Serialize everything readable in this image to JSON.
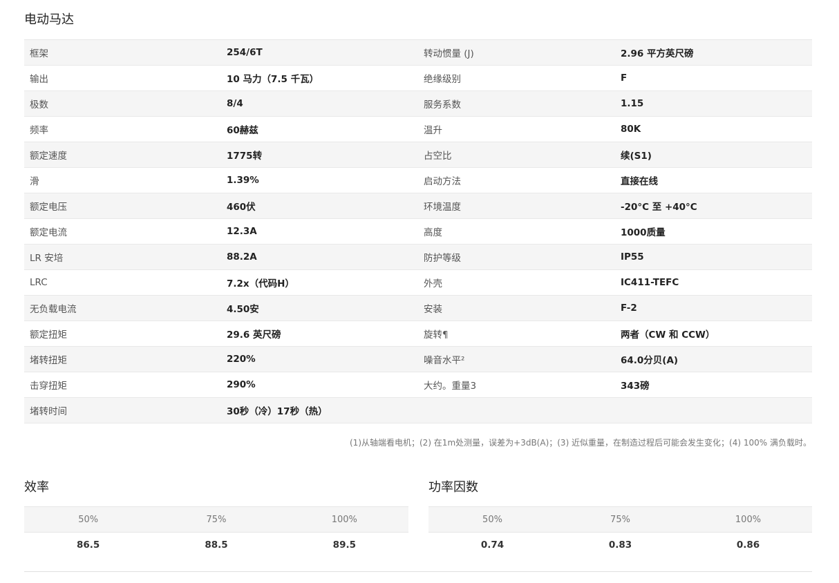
{
  "motor": {
    "title": "电动马达",
    "rows": [
      [
        "框架",
        "254/6T",
        "转动惯量 (J)",
        "2.96 平方英尺磅"
      ],
      [
        "输出",
        "10 马力（7.5 千瓦）",
        "绝缘级别",
        "F"
      ],
      [
        "极数",
        "8/4",
        "服务系数",
        "1.15"
      ],
      [
        "频率",
        "60赫兹",
        "温升",
        "80K"
      ],
      [
        "额定速度",
        "1775转",
        "占空比",
        "续(S1)"
      ],
      [
        "滑",
        "1.39%",
        "启动方法",
        "直接在线"
      ],
      [
        "额定电压",
        "460伏",
        "环境温度",
        "-20°C 至 +40°C"
      ],
      [
        "额定电流",
        "12.3A",
        "高度",
        "1000质量"
      ],
      [
        "LR 安培",
        "88.2A",
        "防护等级",
        "IP55"
      ],
      [
        "LRC",
        "7.2x（代码H）",
        "外壳",
        "IC411-TEFC"
      ],
      [
        "无负载电流",
        "4.50安",
        "安装",
        "F-2"
      ],
      [
        "额定扭矩",
        "29.6 英尺磅",
        "旋转¶",
        "两者（CW 和 CCW）"
      ],
      [
        "堵转扭矩",
        "220%",
        "噪音水平²",
        "64.0分贝(A)"
      ],
      [
        "击穿扭矩",
        "290%",
        "大约。重量3",
        "343磅"
      ],
      [
        "堵转时间",
        "30秒（冷）17秒（热）",
        "",
        ""
      ]
    ],
    "footnote": "(1)从轴端看电机；(2) 在1m处测量，误差为+3dB(A)；(3) 近似重量，在制造过程后可能会发生变化；(4) 100% 满负载时。"
  },
  "efficiency": {
    "title": "效率",
    "headers": [
      "50%",
      "75%",
      "100%"
    ],
    "values": [
      "86.5",
      "88.5",
      "89.5"
    ]
  },
  "power_factor": {
    "title": "功率因数",
    "headers": [
      "50%",
      "75%",
      "100%"
    ],
    "values": [
      "0.74",
      "0.83",
      "0.86"
    ]
  }
}
